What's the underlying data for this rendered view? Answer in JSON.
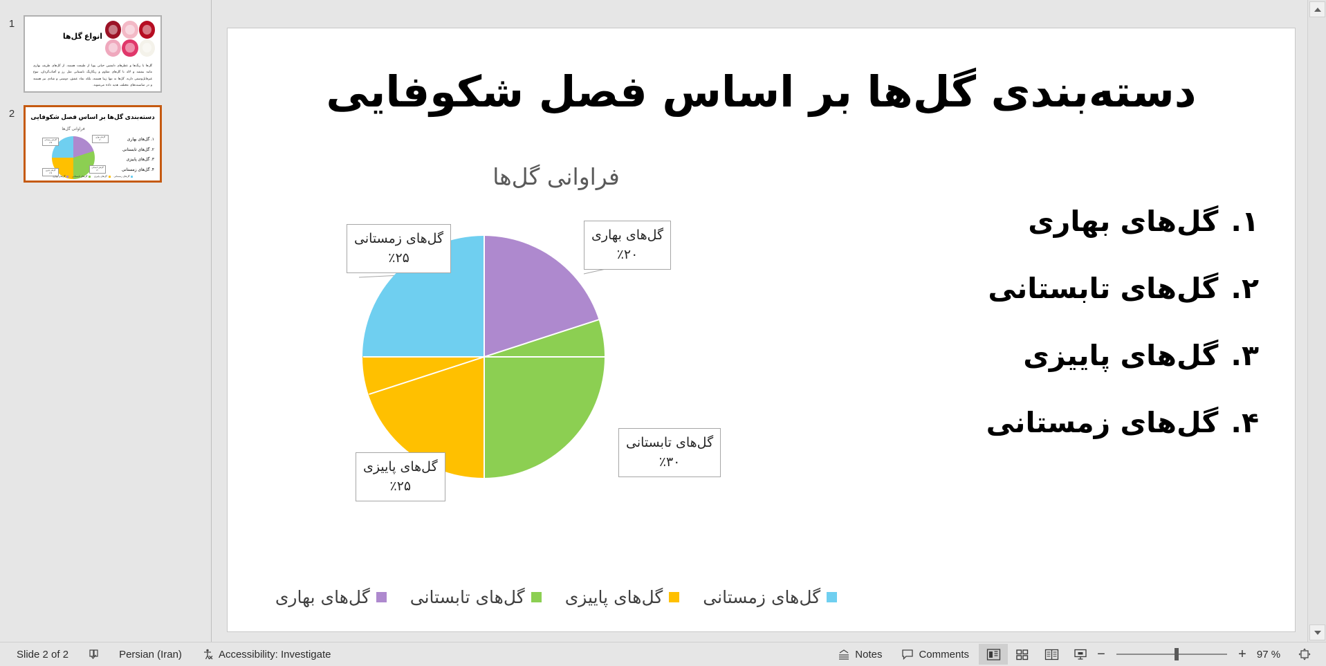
{
  "app": {
    "status": {
      "slide_counter": "Slide 2 of 2",
      "spellcheck_icon": "spellcheck-icon",
      "language": "Persian (Iran)",
      "accessibility_icon": "accessibility-icon",
      "accessibility": "Accessibility: Investigate",
      "notes_icon": "notes-icon",
      "notes": "Notes",
      "comments_icon": "comments-icon",
      "comments": "Comments",
      "view_normal": "normal-view-icon",
      "view_sorter": "slide-sorter-icon",
      "view_reading": "reading-view-icon",
      "view_slideshow": "slideshow-icon",
      "zoom_out": "−",
      "zoom_in": "+",
      "zoom_level": "97 %",
      "fit_slide_icon": "fit-to-window-icon"
    }
  },
  "thumbnails": [
    {
      "number": "1",
      "selected": false,
      "title": "انواع گل‌ها",
      "body": "گل‌ها با رنگ‌ها و عطرهای دلنشین حیاتی پویا از طبیعت هستند. از گل‌های ظریف بهاری مانند بنفشه و لاله تا گل‌های مقاوم و رنگارنگ تابستانی مثل رز و آفتاب‌گردان، تنوع غیرقابل‌وصفی دارند. گل‌ها نه تنها زیبا هستند، بلکه نماد عشق، دوستی و شادی نیز هستند و در مناسبت‌های مختلف هدیه داده می‌شوند."
    },
    {
      "number": "2",
      "selected": true,
      "title": "دسته‌بندی گل‌ها بر اساس فصل شکوفایی"
    }
  ],
  "slide": {
    "title": "دسته‌بندی گل‌ها بر اساس فصل شکوفایی",
    "list": [
      {
        "index": "۱.",
        "label": "گل‌های بهاری"
      },
      {
        "index": "۲.",
        "label": "گل‌های تابستانی"
      },
      {
        "index": "۳.",
        "label": "گل‌های پاییزی"
      },
      {
        "index": "۴.",
        "label": "گل‌های زمستانی"
      }
    ]
  },
  "chart_data": {
    "type": "pie",
    "title": "فراوانی گل‌ها",
    "categories": [
      "گل‌های بهاری",
      "گل‌های تابستانی",
      "گل‌های پاییزی",
      "گل‌های زمستانی"
    ],
    "values": [
      20,
      30,
      25,
      25
    ],
    "value_labels": [
      "٪۲۰",
      "٪۳۰",
      "٪۲۵",
      "٪۲۵"
    ],
    "colors": [
      "#AE89CE",
      "#8CCF52",
      "#FFC000",
      "#6FCFF0"
    ],
    "legend_position": "bottom",
    "legend_order_rtl": [
      "گل‌های زمستانی",
      "گل‌های پاییزی",
      "گل‌های تابستانی",
      "گل‌های بهاری"
    ],
    "start_angle_deg": 0,
    "direction": "clockwise",
    "grid": false
  }
}
